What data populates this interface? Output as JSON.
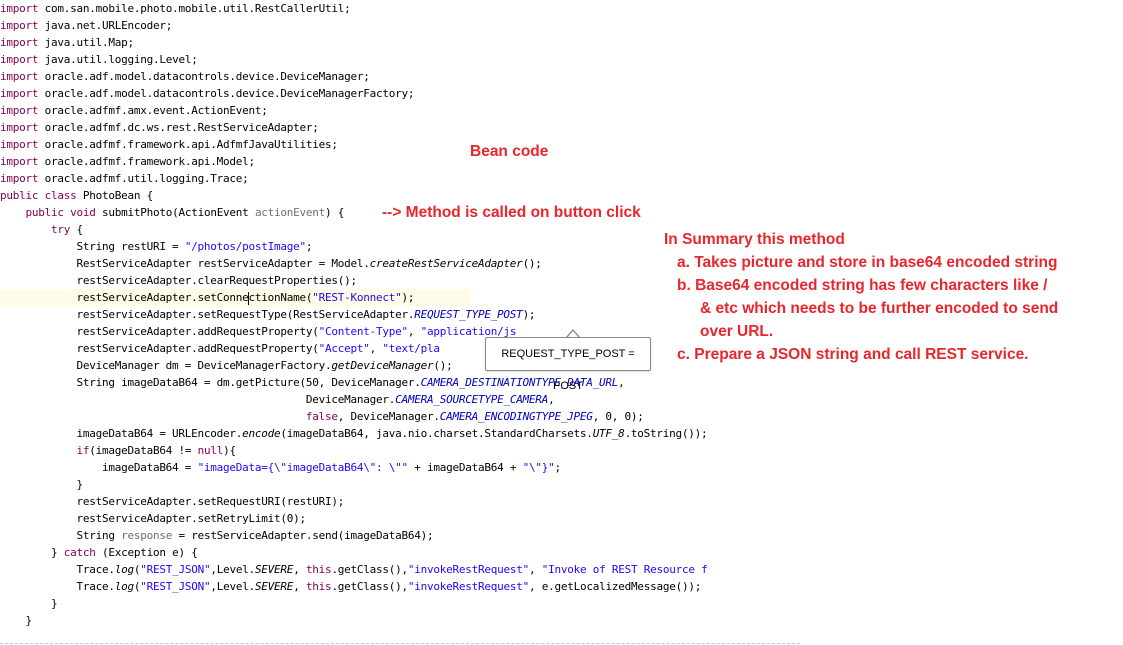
{
  "editor": {
    "lines": [
      [
        [
          "kw",
          "import"
        ],
        [
          "t",
          " com.san.mobile.photo.mobile.util.RestCallerUtil;"
        ]
      ],
      [
        [
          "kw",
          "import"
        ],
        [
          "t",
          " java.net.URLEncoder;"
        ]
      ],
      [
        [
          "kw",
          "import"
        ],
        [
          "t",
          " java.util.Map;"
        ]
      ],
      [
        [
          "kw",
          "import"
        ],
        [
          "t",
          " java.util.logging.Level;"
        ]
      ],
      [
        [
          "kw",
          "import"
        ],
        [
          "t",
          " oracle.adf.model.datacontrols.device.DeviceManager;"
        ]
      ],
      [
        [
          "kw",
          "import"
        ],
        [
          "t",
          " oracle.adf.model.datacontrols.device.DeviceManagerFactory;"
        ]
      ],
      [
        [
          "kw",
          "import"
        ],
        [
          "t",
          " oracle.adfmf.amx.event.ActionEvent;"
        ]
      ],
      [
        [
          "kw",
          "import"
        ],
        [
          "t",
          " oracle.adfmf.dc.ws.rest.RestServiceAdapter;"
        ]
      ],
      [
        [
          "kw",
          "import"
        ],
        [
          "t",
          " oracle.adfmf.framework.api.AdfmfJavaUtilities;"
        ]
      ],
      [
        [
          "kw",
          "import"
        ],
        [
          "t",
          " oracle.adfmf.framework.api.Model;"
        ]
      ],
      [
        [
          "kw",
          "import"
        ],
        [
          "t",
          " oracle.adfmf.util.logging.Trace;"
        ]
      ],
      [
        [
          "kw",
          "public class"
        ],
        [
          "t",
          " PhotoBean {"
        ]
      ],
      [
        [
          "t",
          "    "
        ],
        [
          "kw",
          "public void"
        ],
        [
          "t",
          " submitPhoto(ActionEvent "
        ],
        [
          "param",
          "actionEvent"
        ],
        [
          "t",
          ") {"
        ]
      ],
      [
        [
          "t",
          "        "
        ],
        [
          "kw",
          "try"
        ],
        [
          "t",
          " {"
        ]
      ],
      [
        [
          "t",
          "            String restURI = "
        ],
        [
          "str",
          "\"/photos/postImage\""
        ],
        [
          "t",
          ";"
        ]
      ],
      [
        [
          "t",
          "            RestServiceAdapter restServiceAdapter = Model."
        ],
        [
          "mi",
          "createRestServiceAdapter"
        ],
        [
          "t",
          "();"
        ]
      ],
      [
        [
          "t",
          "            restServiceAdapter.clearRequestProperties();"
        ]
      ],
      [
        [
          "t",
          "            restServiceAdapter."
        ],
        [
          "t",
          "setConne"
        ],
        [
          "caret",
          ""
        ],
        [
          "t",
          "ctionName("
        ],
        [
          "str",
          "\"REST-Konnect\""
        ],
        [
          "t",
          ");"
        ]
      ],
      [
        [
          "t",
          "            restServiceAdapter.setRequestType(RestServiceAdapter."
        ],
        [
          "st",
          "REQUEST_TYPE_POST"
        ],
        [
          "t",
          ");"
        ]
      ],
      [
        [
          "t",
          "            restServiceAdapter.addRequestProperty("
        ],
        [
          "str",
          "\"Content-Type\""
        ],
        [
          "t",
          ", "
        ],
        [
          "str",
          "\"application/js"
        ]
      ],
      [
        [
          "t",
          "            restServiceAdapter.addRequestProperty("
        ],
        [
          "str",
          "\"Accept\""
        ],
        [
          "t",
          ", "
        ],
        [
          "str",
          "\"text/pla"
        ]
      ],
      [
        [
          "t",
          "            DeviceManager dm = DeviceManagerFactory."
        ],
        [
          "mi",
          "getDeviceManager"
        ],
        [
          "t",
          "();"
        ]
      ],
      [
        [
          "t",
          "            String imageDataB64 = dm.getPicture(50, DeviceManager."
        ],
        [
          "st",
          "CAMERA_DESTINATIONTYPE_DATA_URL"
        ],
        [
          "t",
          ","
        ]
      ],
      [
        [
          "t",
          "                                                DeviceManager."
        ],
        [
          "st",
          "CAMERA_SOURCETYPE_CAMERA"
        ],
        [
          "t",
          ","
        ]
      ],
      [
        [
          "t",
          "                                                "
        ],
        [
          "kw",
          "false"
        ],
        [
          "t",
          ", DeviceManager."
        ],
        [
          "st",
          "CAMERA_ENCODINGTYPE_JPEG"
        ],
        [
          "t",
          ", 0, 0);"
        ]
      ],
      [
        [
          "t",
          "            imageDataB64 = URLEncoder."
        ],
        [
          "mi",
          "encode"
        ],
        [
          "t",
          "(imageDataB64, java.nio.charset.StandardCharsets."
        ],
        [
          "mi",
          "UTF_8"
        ],
        [
          "t",
          ".toString());"
        ]
      ],
      [
        [
          "t",
          "            "
        ],
        [
          "kw",
          "if"
        ],
        [
          "t",
          "(imageDataB64 != "
        ],
        [
          "kw",
          "null"
        ],
        [
          "t",
          "){"
        ]
      ],
      [
        [
          "t",
          "                imageDataB64 = "
        ],
        [
          "str",
          "\"imageData={\\\"imageDataB64\\\": \\\"\""
        ],
        [
          "t",
          " + imageDataB64 + "
        ],
        [
          "str",
          "\"\\\"}\""
        ],
        [
          "t",
          ";"
        ]
      ],
      [
        [
          "t",
          "            }"
        ]
      ],
      [
        [
          "t",
          "            restServiceAdapter.setRequestURI(restURI);"
        ]
      ],
      [
        [
          "t",
          "            restServiceAdapter.setRetryLimit(0);"
        ]
      ],
      [
        [
          "t",
          "            String "
        ],
        [
          "param",
          "response"
        ],
        [
          "t",
          " = restServiceAdapter.send(imageDataB64);"
        ]
      ],
      [
        [
          "t",
          "        } "
        ],
        [
          "kw",
          "catch"
        ],
        [
          "t",
          " (Exception e) {"
        ]
      ],
      [
        [
          "t",
          "            Trace."
        ],
        [
          "mi",
          "log"
        ],
        [
          "t",
          "("
        ],
        [
          "str",
          "\"REST_JSON\""
        ],
        [
          "t",
          ",Level."
        ],
        [
          "mi",
          "SEVERE"
        ],
        [
          "t",
          ", "
        ],
        [
          "kw",
          "this"
        ],
        [
          "t",
          ".getClass(),"
        ],
        [
          "str",
          "\"invokeRestRequest\""
        ],
        [
          "t",
          ", "
        ],
        [
          "str",
          "\"Invoke of REST Resource f"
        ]
      ],
      [
        [
          "t",
          "            Trace."
        ],
        [
          "mi",
          "log"
        ],
        [
          "t",
          "("
        ],
        [
          "str",
          "\"REST_JSON\""
        ],
        [
          "t",
          ",Level."
        ],
        [
          "mi",
          "SEVERE"
        ],
        [
          "t",
          ", "
        ],
        [
          "kw",
          "this"
        ],
        [
          "t",
          ".getClass(),"
        ],
        [
          "str",
          "\"invokeRestRequest\""
        ],
        [
          "t",
          ", e.getLocalizedMessage());"
        ]
      ],
      [
        [
          "t",
          "        }"
        ]
      ],
      [
        [
          "t",
          "    }"
        ]
      ]
    ]
  },
  "tooltip": {
    "text": "REQUEST_TYPE_POST = POST"
  },
  "annotations": {
    "bean_code": "Bean code",
    "method_called": "--> Method is called on button click",
    "summary_title": "In Summary this method",
    "summary_a": "a. Takes picture and store in base64 encoded string",
    "summary_b_line1": "b. Base64 encoded string has few characters like /",
    "summary_b_line2": "& etc which needs to be further encoded to send",
    "summary_b_line3": "over URL.",
    "summary_c": "c. Prepare a JSON string and call REST service."
  },
  "colors": {
    "keyword": "#7f0055",
    "string": "#2a00ff",
    "static_field": "#0000c0",
    "parameter": "#6f6f6f",
    "annotation": "#e8262b",
    "current_line": "#fffbe6"
  }
}
